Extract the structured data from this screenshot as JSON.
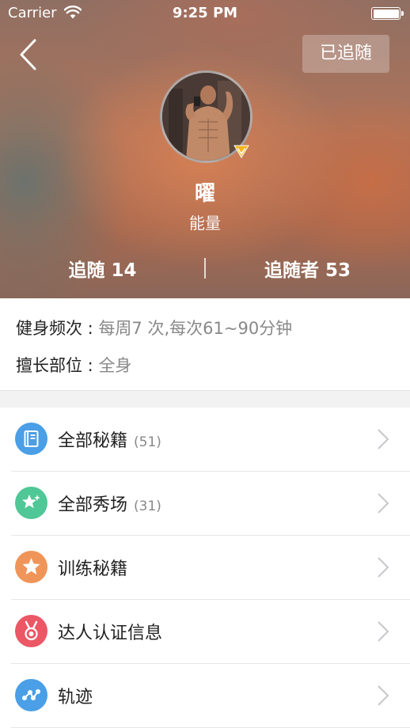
{
  "status_bar": {
    "carrier": "Carrier",
    "time": "9:25 PM"
  },
  "nav": {
    "follow_button_label": "已追随"
  },
  "profile": {
    "name": "曜",
    "subtitle": "能量",
    "following": "追随 14",
    "followers": "追随者 53"
  },
  "info": {
    "frequency_label": "健身频次 : ",
    "frequency_value": "每周7 次,每次61~90分钟",
    "part_label": "擅长部位 : ",
    "part_value": "全身"
  },
  "menu": [
    {
      "label": "全部秘籍",
      "count": "(51)",
      "icon": "book-icon",
      "color": "#4a9fe6"
    },
    {
      "label": "全部秀场",
      "count": "(31)",
      "icon": "sparkle-star-icon",
      "color": "#4fc796"
    },
    {
      "label": "训练秘籍",
      "count": "",
      "icon": "star-icon",
      "color": "#f0955a"
    },
    {
      "label": "达人认证信息",
      "count": "",
      "icon": "medal-icon",
      "color": "#ec5766"
    },
    {
      "label": "轨迹",
      "count": "",
      "icon": "route-icon",
      "color": "#4a9fe6"
    }
  ]
}
